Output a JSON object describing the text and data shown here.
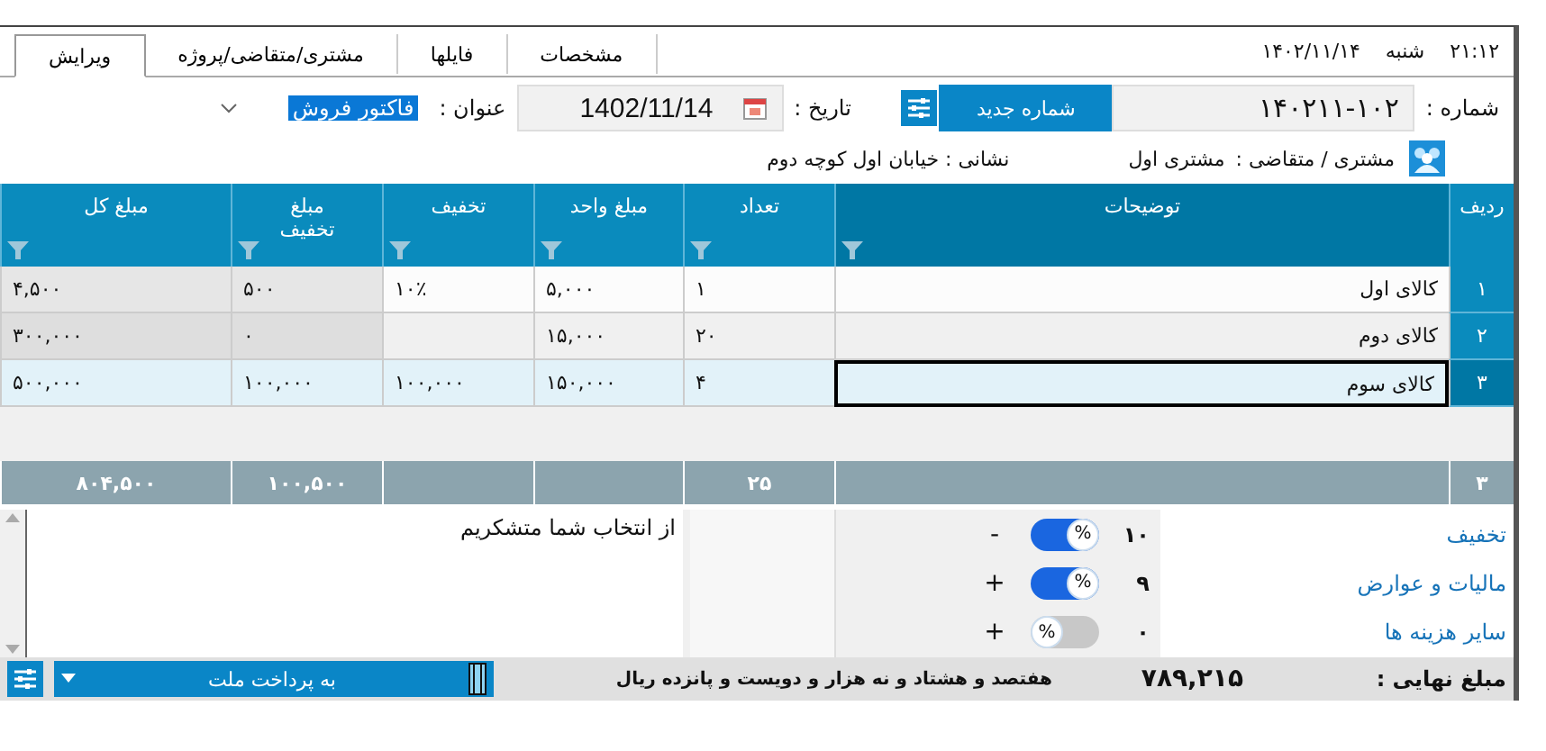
{
  "header": {
    "time": "۲۱:۱۲",
    "day": "شنبه",
    "date": "۱۴۰۲/۱۱/۱۴"
  },
  "tabs": [
    {
      "label": "مشخصات",
      "selected": false
    },
    {
      "label": "فایلها",
      "selected": false
    },
    {
      "label": "مشتری/متقاضی/پروژه",
      "selected": false
    },
    {
      "label": "ویرایش",
      "selected": true
    }
  ],
  "form": {
    "number_label": "شماره :",
    "number": "۱۴۰۲۱۱-۱۰۲",
    "new_number_button": "شماره جدید",
    "date_label": "تاریخ :",
    "date": "1402/11/14",
    "title_label": "عنوان :",
    "title": "فاکتور فروش",
    "customer_label": "مشتری / متقاضی :",
    "customer": "مشتری اول",
    "address": "نشانی : خیابان اول کوچه دوم"
  },
  "table": {
    "columns": [
      {
        "label": "ردیف",
        "filter": false,
        "computed": false
      },
      {
        "label": "توضیحات",
        "filter": true,
        "computed": false
      },
      {
        "label": "تعداد",
        "filter": true,
        "computed": false
      },
      {
        "label": "مبلغ واحد",
        "filter": true,
        "computed": false
      },
      {
        "label": "تخفیف",
        "filter": true,
        "computed": false
      },
      {
        "label": "مبلغ تخفیف",
        "filter": true,
        "computed": true
      },
      {
        "label": "مبلغ کل",
        "filter": true,
        "computed": true
      }
    ],
    "rows": [
      {
        "selected": false,
        "row": "۱",
        "description": "کالای اول",
        "quantity": "۱",
        "unit_price": "۵,۰۰۰",
        "discount": "۱۰٪",
        "discount_amount": "۵۰۰",
        "total": "۴,۵۰۰"
      },
      {
        "selected": false,
        "row": "۲",
        "description": "کالای دوم",
        "quantity": "۲۰",
        "unit_price": "۱۵,۰۰۰",
        "discount_amount": "۰",
        "total": "۳۰۰,۰۰۰"
      },
      {
        "selected": true,
        "row": "۳",
        "description": "کالای سوم",
        "quantity": "۴",
        "unit_price": "۱۵۰,۰۰۰",
        "discount": "۱۰۰,۰۰۰",
        "discount_amount": "۱۰۰,۰۰۰",
        "total": "۵۰۰,۰۰۰"
      }
    ],
    "totals": {
      "row": "۳",
      "quantity": "۲۵",
      "discount_amount": "۱۰۰,۵۰۰",
      "total": "۸۰۴,۵۰۰"
    }
  },
  "adjustments": [
    {
      "label": "تخفیف",
      "value": "۱۰",
      "toggle": "%",
      "percent": true,
      "sign": "-"
    },
    {
      "label": "مالیات  و عوارض",
      "value": "۹",
      "toggle": "%",
      "percent": true,
      "sign": "+"
    },
    {
      "label": "سایر هزینه ها",
      "value": "۰",
      "toggle": "%",
      "percent": false,
      "sign": "+"
    }
  ],
  "note": "از انتخاب شما متشکریم",
  "footer": {
    "final_label": "مبلغ نهایی :",
    "final_amount": "۷۸۹,۲۱۵",
    "in_words": "هفتصد و هشتاد و نه هزار و دویست و پانزده ریال",
    "payment": "به پرداخت ملت"
  }
}
